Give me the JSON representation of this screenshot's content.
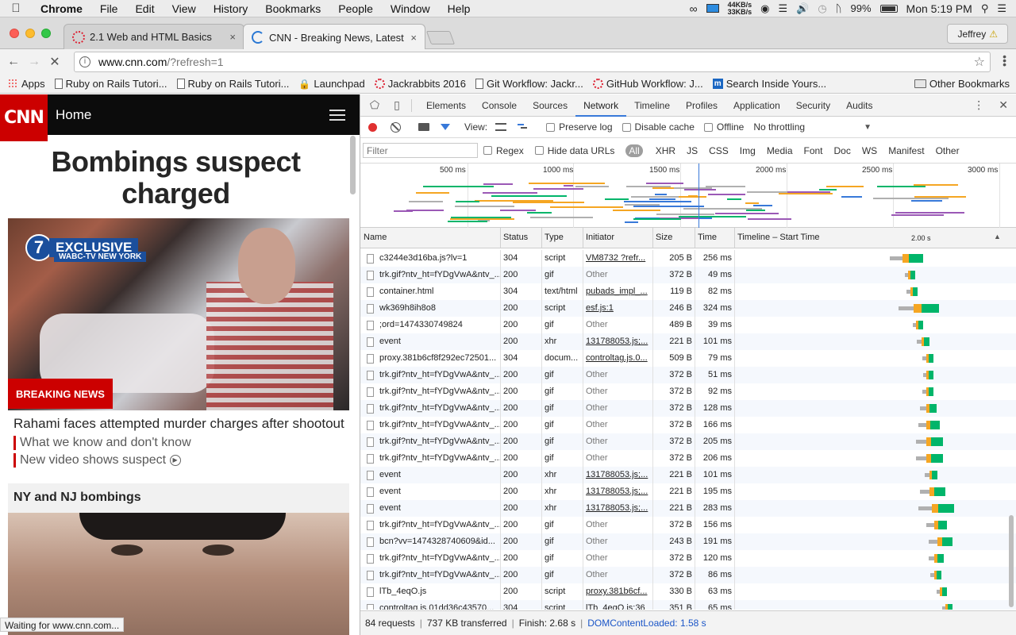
{
  "menubar": {
    "app": "Chrome",
    "items": [
      "File",
      "Edit",
      "View",
      "History",
      "Bookmarks",
      "People",
      "Window",
      "Help"
    ],
    "net_up": "44KB/s",
    "net_down": "33KB/s",
    "battery": "99%",
    "clock": "Mon 5:19 PM"
  },
  "tabs": [
    {
      "title": "2.1 Web and HTML Basics",
      "close": "×"
    },
    {
      "title": "CNN - Breaking News, Latest N",
      "close": "×"
    }
  ],
  "profile": "Jeffrey",
  "address": {
    "host": "www.cnn.com",
    "path": "/?refresh=1"
  },
  "bookmarks": [
    {
      "label": "Apps",
      "icon": "apps"
    },
    {
      "label": "Ruby on Rails Tutori...",
      "icon": "page"
    },
    {
      "label": "Ruby on Rails Tutori...",
      "icon": "page"
    },
    {
      "label": "Launchpad",
      "icon": "lock"
    },
    {
      "label": "Jackrabbits 2016",
      "icon": "ring"
    },
    {
      "label": "Git Workflow: Jackr...",
      "icon": "page"
    },
    {
      "label": "GitHub Workflow: J...",
      "icon": "ring"
    },
    {
      "label": "Search Inside Yours...",
      "icon": "m"
    }
  ],
  "other_bookmarks": "Other Bookmarks",
  "cnn": {
    "logo": "CNN",
    "nav_title": "Home",
    "headline": "Bombings suspect charged",
    "hero_badge": "EXCLUSIVE",
    "hero_badge_num": "7",
    "hero_station": "WABC-TV NEW YORK",
    "breaking": "BREAKING NEWS",
    "summary": "Rahami faces attempted murder charges after shootout",
    "link1": "What we know and don't know",
    "link2": "New video shows suspect",
    "section": "NY and NJ bombings",
    "status_bubble": "Waiting for www.cnn.com..."
  },
  "devtools": {
    "tabs": [
      "Elements",
      "Console",
      "Sources",
      "Network",
      "Timeline",
      "Profiles",
      "Application",
      "Security",
      "Audits"
    ],
    "active_tab": "Network",
    "view_label": "View:",
    "preserve_log": "Preserve log",
    "disable_cache": "Disable cache",
    "offline": "Offline",
    "throttling": "No throttling",
    "filter_placeholder": "Filter",
    "regex": "Regex",
    "hide_data_urls": "Hide data URLs",
    "all": "All",
    "types": [
      "XHR",
      "JS",
      "CSS",
      "Img",
      "Media",
      "Font",
      "Doc",
      "WS",
      "Manifest",
      "Other"
    ],
    "ticks": [
      "500 ms",
      "1000 ms",
      "1500 ms",
      "2000 ms",
      "2500 ms",
      "3000 ms"
    ],
    "columns": [
      "Name",
      "Status",
      "Type",
      "Initiator",
      "Size",
      "Time",
      "Timeline – Start Time"
    ],
    "timeline_mark": "2.00 s",
    "rows": [
      {
        "name": "c3244e3d16ba.js?lv=1",
        "status": "304",
        "type": "script",
        "initiator": "VM8732 ?refr...",
        "link": true,
        "size": "205 B",
        "time": "256 ms",
        "tl": 0.72
      },
      {
        "name": "trk.gif?ntv_ht=fYDgVwA&ntv_...",
        "status": "200",
        "type": "gif",
        "initiator": "Other",
        "link": false,
        "size": "372 B",
        "time": "49 ms",
        "tl": 0.74
      },
      {
        "name": "container.html",
        "status": "304",
        "type": "text/html",
        "initiator": "pubads_impl_...",
        "link": true,
        "size": "119 B",
        "time": "82 ms",
        "tl": 0.75
      },
      {
        "name": "wk369h8ih8o8",
        "status": "200",
        "type": "script",
        "initiator": "esf.js:1",
        "link": true,
        "size": "246 B",
        "time": "324 ms",
        "tl": 0.76
      },
      {
        "name": ";ord=1474330749824",
        "status": "200",
        "type": "gif",
        "initiator": "Other",
        "link": false,
        "size": "489 B",
        "time": "39 ms",
        "tl": 0.77
      },
      {
        "name": "event",
        "status": "200",
        "type": "xhr",
        "initiator": "131788053.js;...",
        "link": true,
        "size": "221 B",
        "time": "101 ms",
        "tl": 0.79
      },
      {
        "name": "proxy.381b6cf8f292ec72501...",
        "status": "304",
        "type": "docum...",
        "initiator": "controltag.js.0...",
        "link": true,
        "size": "509 B",
        "time": "79 ms",
        "tl": 0.81
      },
      {
        "name": "trk.gif?ntv_ht=fYDgVwA&ntv_...",
        "status": "200",
        "type": "gif",
        "initiator": "Other",
        "link": false,
        "size": "372 B",
        "time": "51 ms",
        "tl": 0.81
      },
      {
        "name": "trk.gif?ntv_ht=fYDgVwA&ntv_...",
        "status": "200",
        "type": "gif",
        "initiator": "Other",
        "link": false,
        "size": "372 B",
        "time": "92 ms",
        "tl": 0.81
      },
      {
        "name": "trk.gif?ntv_ht=fYDgVwA&ntv_...",
        "status": "200",
        "type": "gif",
        "initiator": "Other",
        "link": false,
        "size": "372 B",
        "time": "128 ms",
        "tl": 0.81
      },
      {
        "name": "trk.gif?ntv_ht=fYDgVwA&ntv_...",
        "status": "200",
        "type": "gif",
        "initiator": "Other",
        "link": false,
        "size": "372 B",
        "time": "166 ms",
        "tl": 0.81
      },
      {
        "name": "trk.gif?ntv_ht=fYDgVwA&ntv_...",
        "status": "200",
        "type": "gif",
        "initiator": "Other",
        "link": false,
        "size": "372 B",
        "time": "205 ms",
        "tl": 0.81
      },
      {
        "name": "trk.gif?ntv_ht=fYDgVwA&ntv_...",
        "status": "200",
        "type": "gif",
        "initiator": "Other",
        "link": false,
        "size": "372 B",
        "time": "206 ms",
        "tl": 0.81
      },
      {
        "name": "event",
        "status": "200",
        "type": "xhr",
        "initiator": "131788053.js;...",
        "link": true,
        "size": "221 B",
        "time": "101 ms",
        "tl": 0.82
      },
      {
        "name": "event",
        "status": "200",
        "type": "xhr",
        "initiator": "131788053.js;...",
        "link": true,
        "size": "221 B",
        "time": "195 ms",
        "tl": 0.82
      },
      {
        "name": "event",
        "status": "200",
        "type": "xhr",
        "initiator": "131788053.js;...",
        "link": true,
        "size": "221 B",
        "time": "283 ms",
        "tl": 0.83
      },
      {
        "name": "trk.gif?ntv_ht=fYDgVwA&ntv_...",
        "status": "200",
        "type": "gif",
        "initiator": "Other",
        "link": false,
        "size": "372 B",
        "time": "156 ms",
        "tl": 0.84
      },
      {
        "name": "bcn?vv=1474328740609&id...",
        "status": "200",
        "type": "gif",
        "initiator": "Other",
        "link": false,
        "size": "243 B",
        "time": "191 ms",
        "tl": 0.85
      },
      {
        "name": "trk.gif?ntv_ht=fYDgVwA&ntv_...",
        "status": "200",
        "type": "gif",
        "initiator": "Other",
        "link": false,
        "size": "372 B",
        "time": "120 ms",
        "tl": 0.84
      },
      {
        "name": "trk.gif?ntv_ht=fYDgVwA&ntv_...",
        "status": "200",
        "type": "gif",
        "initiator": "Other",
        "link": false,
        "size": "372 B",
        "time": "86 ms",
        "tl": 0.84
      },
      {
        "name": "lTb_4eqO.js",
        "status": "200",
        "type": "script",
        "initiator": "proxy.381b6cf...",
        "link": true,
        "size": "330 B",
        "time": "63 ms",
        "tl": 0.86
      },
      {
        "name": "controltag.js.01dd36c43570...",
        "status": "304",
        "type": "script",
        "initiator": "lTb_4eqO.js:36",
        "link": true,
        "size": "351 B",
        "time": "65 ms",
        "tl": 0.88
      }
    ],
    "summary": {
      "requests": "84 requests",
      "transferred": "737 KB transferred",
      "finish": "Finish: 2.68 s",
      "dcl": "DOMContentLoaded: 1.58 s"
    }
  },
  "colors": {
    "accent": "#3879d9",
    "cnn_red": "#cc0000",
    "wait": "#00b56a",
    "receive": "#f5a623",
    "queue": "#b0b0b0"
  }
}
